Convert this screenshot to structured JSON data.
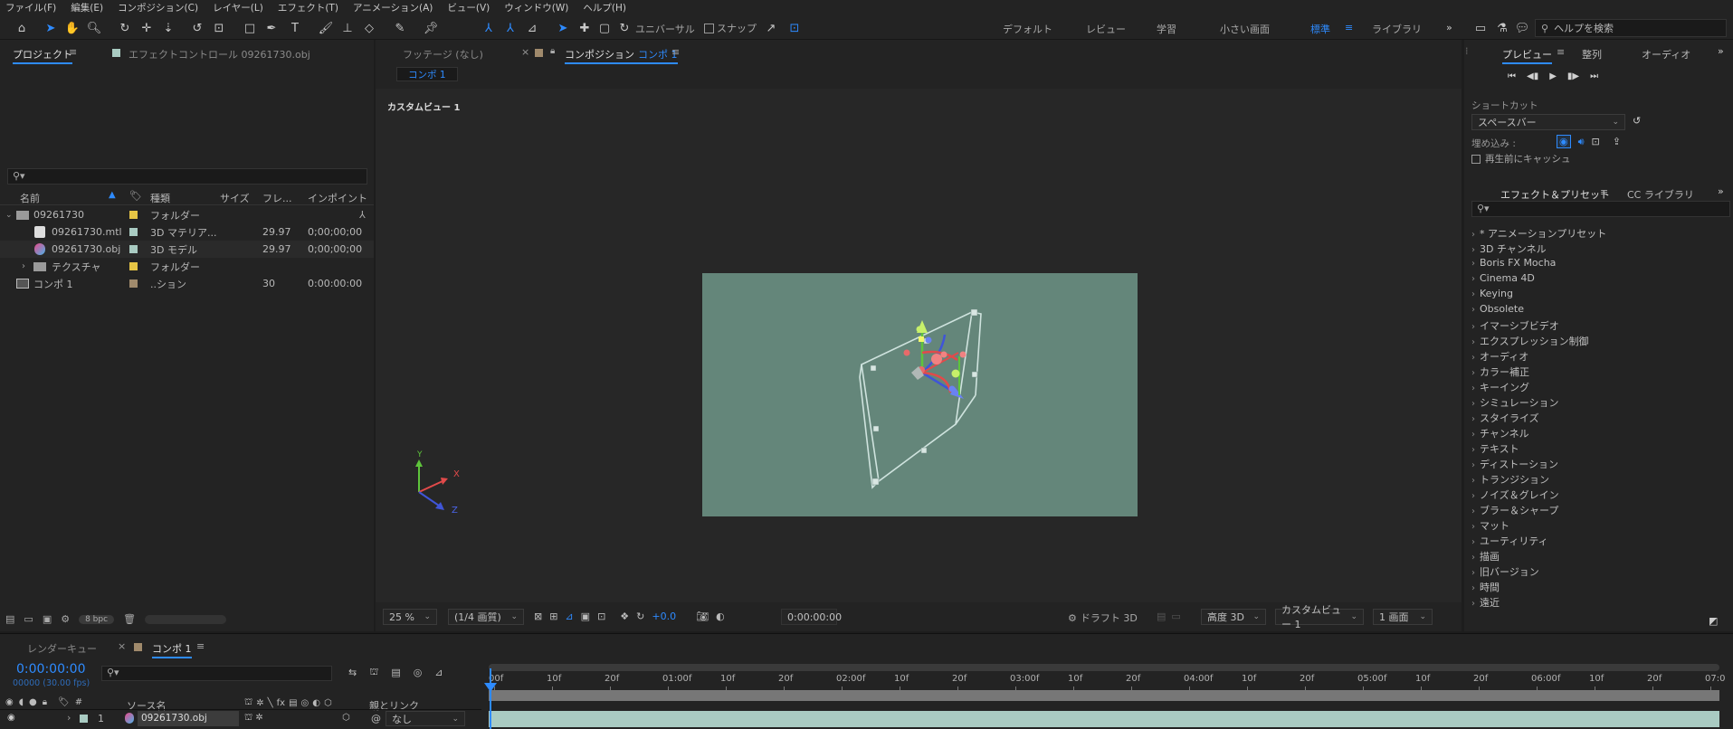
{
  "menu": [
    "ファイル(F)",
    "編集(E)",
    "コンポジション(C)",
    "レイヤー(L)",
    "エフェクト(T)",
    "アニメーション(A)",
    "ビュー(V)",
    "ウィンドウ(W)",
    "ヘルプ(H)"
  ],
  "toolbar": {
    "universal_label": "ユニバーサル",
    "snap_label": "スナップ",
    "workspaces": [
      "デフォルト",
      "レビュー",
      "学習",
      "小さい画面",
      "標準",
      "ライブラリ"
    ],
    "active_workspace": "標準",
    "help_search_placeholder": "ヘルプを検索"
  },
  "project": {
    "tab_project": "プロジェクト",
    "tab_effect_controls": "エフェクトコントロール 09261730.obj",
    "search_placeholder": "",
    "columns": [
      "名前",
      "種類",
      "サイズ",
      "フレ...",
      "インポイント"
    ],
    "rows": [
      {
        "name": "09261730",
        "type": "フォルダー",
        "fps": "",
        "in": "",
        "color": "#e6c545",
        "kind": "folder"
      },
      {
        "name": "09261730.mtl",
        "type": "3D マテリア...",
        "fps": "29.97",
        "in": "0;00;00;00",
        "color": "#a9cbc2",
        "kind": "mtl"
      },
      {
        "name": "09261730.obj",
        "type": "3D モデル",
        "fps": "29.97",
        "in": "0;00;00;00",
        "color": "#a9cbc2",
        "kind": "obj"
      },
      {
        "name": "テクスチャ",
        "type": "フォルダー",
        "fps": "",
        "in": "",
        "color": "#e6c545",
        "kind": "folder"
      },
      {
        "name": "コンポ 1",
        "type": "..ション",
        "fps": "30",
        "in": "0:00:00:00",
        "color": "#a08a6c",
        "kind": "comp"
      }
    ],
    "bpc_label": "8 bpc"
  },
  "comp": {
    "tab_footage": "フッテージ (なし)",
    "tab_comp_prefix": "コンポジション",
    "tab_comp_name": "コンポ 1",
    "breadcrumb": "コンポ 1",
    "view_label": "カスタムビュー 1",
    "axis_x": "X",
    "axis_y": "Y",
    "axis_z": "Z",
    "bottom": {
      "zoom": "25 %",
      "resolution": "(1/4 画質)",
      "exposure": "+0.0",
      "timecode": "0:00:00:00",
      "draft3d": "ドラフト 3D",
      "renderer": "高度 3D",
      "view": "カスタムビュー 1",
      "layout": "1 画面"
    }
  },
  "preview": {
    "tabs": [
      "プレビュー",
      "整列",
      "オーディオ"
    ],
    "shortcut_label": "ショートカット",
    "shortcut_value": "スペースバー",
    "embed_label": "埋め込み :",
    "cache_label": "再生前にキャッシュ"
  },
  "effects": {
    "tabs": [
      "エフェクト＆プリセット",
      "CC ライブラリ"
    ],
    "items": [
      "* アニメーションプリセット",
      "3D チャンネル",
      "Boris FX Mocha",
      "Cinema 4D",
      "Keying",
      "Obsolete",
      "イマーシブビデオ",
      "エクスプレッション制御",
      "オーディオ",
      "カラー補正",
      "キーイング",
      "シミュレーション",
      "スタイライズ",
      "チャンネル",
      "テキスト",
      "ディストーション",
      "トランジション",
      "ノイズ＆グレイン",
      "ブラー＆シャープ",
      "マット",
      "ユーティリティ",
      "描画",
      "旧バージョン",
      "時間",
      "遠近"
    ]
  },
  "timeline": {
    "tab_render_queue": "レンダーキュー",
    "tab_comp": "コンポ 1",
    "timecode": "0:00:00:00",
    "fps_info": "00000 (30.00 fps)",
    "col_source": "ソース名",
    "col_parent": "親とリンク",
    "layer_index": "1",
    "layer_name": "09261730.obj",
    "parent_value": "なし",
    "ruler": [
      "00f",
      "10f",
      "20f",
      "01:00f",
      "10f",
      "20f",
      "02:00f",
      "10f",
      "20f",
      "03:00f",
      "10f",
      "20f",
      "04:00f",
      "10f",
      "20f",
      "05:00f",
      "10f",
      "20f",
      "06:00f",
      "10f",
      "20f",
      "07:0"
    ]
  },
  "colors": {
    "accent": "#2e8bff",
    "comp_bg": "#64867a",
    "layer_bar": "#a9cbc2"
  }
}
